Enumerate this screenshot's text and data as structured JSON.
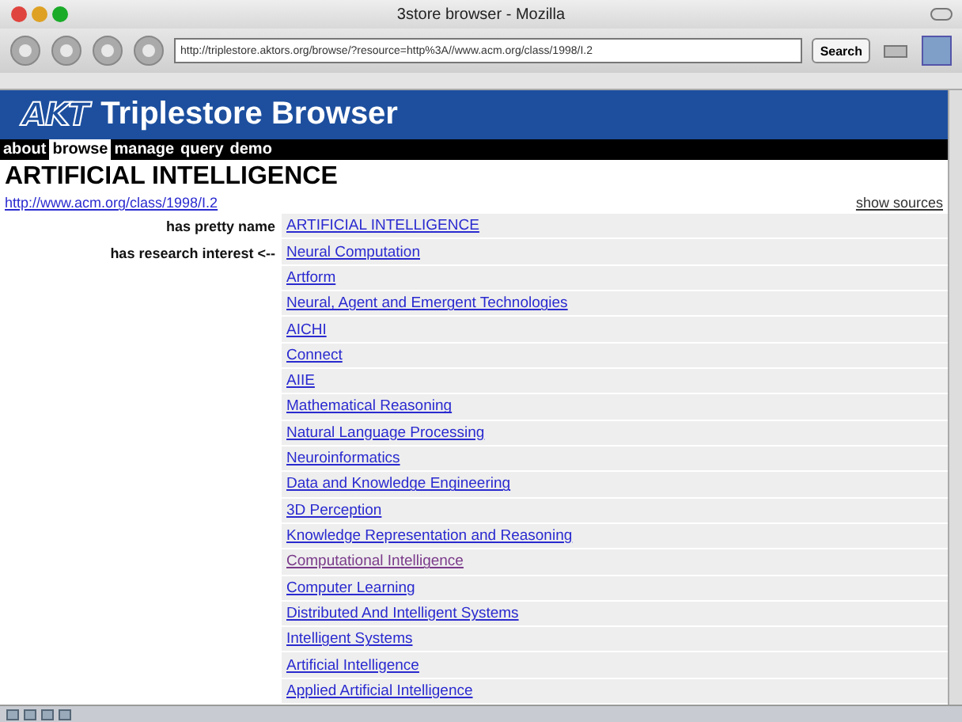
{
  "window": {
    "title": "3store browser - Mozilla"
  },
  "toolbar": {
    "url": "http://triplestore.aktors.org/browse/?resource=http%3A//www.acm.org/class/1998/I.2",
    "search_button": "Search"
  },
  "banner": {
    "logo": "AKT",
    "title": "Triplestore Browser"
  },
  "nav": [
    {
      "label": "about",
      "selected": false
    },
    {
      "label": "browse",
      "selected": true
    },
    {
      "label": "manage",
      "selected": false
    },
    {
      "label": "query",
      "selected": false
    },
    {
      "label": "demo",
      "selected": false
    }
  ],
  "heading": "ARTIFICIAL INTELLIGENCE",
  "resource_link": "http://www.acm.org/class/1998/I.2",
  "show_sources": "show sources",
  "properties": [
    {
      "label": "has pretty name",
      "values": [
        {
          "text": "ARTIFICIAL INTELLIGENCE",
          "visited": false
        }
      ]
    },
    {
      "label": "has research interest <--",
      "values": [
        {
          "text": "Neural Computation",
          "visited": false
        },
        {
          "text": "Artform",
          "visited": false
        },
        {
          "text": "Neural, Agent and Emergent Technologies",
          "visited": false
        },
        {
          "text": "AICHI",
          "visited": false
        },
        {
          "text": "Connect",
          "visited": false
        },
        {
          "text": "AIIE",
          "visited": false
        },
        {
          "text": "Mathematical Reasoning",
          "visited": false
        },
        {
          "text": "Natural Language Processing",
          "visited": false
        },
        {
          "text": "Neuroinformatics",
          "visited": false
        },
        {
          "text": "Data and Knowledge Engineering",
          "visited": false
        },
        {
          "text": "3D Perception",
          "visited": false
        },
        {
          "text": "Knowledge Representation and Reasoning",
          "visited": false
        },
        {
          "text": "Computational Intelligence",
          "visited": true
        },
        {
          "text": "Computer Learning",
          "visited": false
        },
        {
          "text": "Distributed And Intelligent Systems",
          "visited": false
        },
        {
          "text": "Intelligent Systems",
          "visited": false
        },
        {
          "text": "Artificial Intelligence",
          "visited": false
        },
        {
          "text": "Applied Artificial Intelligence",
          "visited": false
        }
      ]
    }
  ]
}
